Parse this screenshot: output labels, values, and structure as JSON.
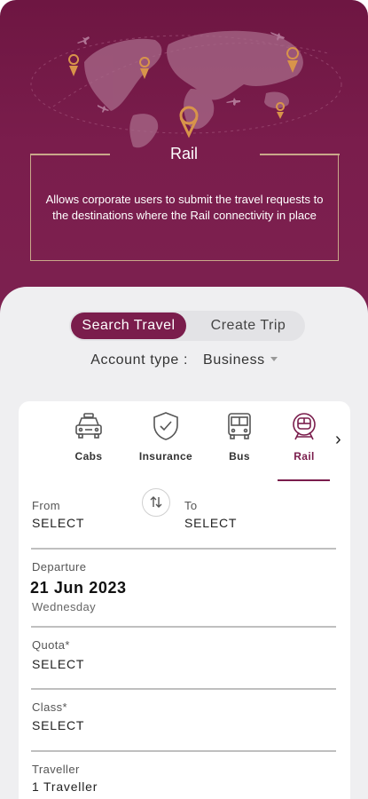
{
  "header": {
    "title": "Rail",
    "description": "Allows corporate users to submit the travel requests to the destinations where the Rail connectivity in place"
  },
  "tabs": [
    {
      "label": "Search Travel",
      "active": true
    },
    {
      "label": "Create Trip",
      "active": false
    }
  ],
  "account_type": {
    "label": "Account type :",
    "value": "Business"
  },
  "modes": [
    {
      "label": "Cabs",
      "icon": "taxi-icon"
    },
    {
      "label": "Insurance",
      "icon": "shield-check-icon"
    },
    {
      "label": "Bus",
      "icon": "bus-icon"
    },
    {
      "label": "Rail",
      "icon": "train-icon",
      "active": true
    }
  ],
  "form": {
    "from": {
      "label": "From",
      "value": "SELECT"
    },
    "to": {
      "label": "To",
      "value": "SELECT"
    },
    "departure": {
      "label": "Departure",
      "date": "21 Jun 2023",
      "day": "Wednesday"
    },
    "quota": {
      "label": "Quota*",
      "value": "SELECT"
    },
    "class": {
      "label": "Class*",
      "value": "SELECT"
    },
    "traveller": {
      "label": "Traveller",
      "value": "1 Traveller"
    }
  },
  "colors": {
    "brand": "#7a1d4c",
    "accent": "#c9823e"
  }
}
